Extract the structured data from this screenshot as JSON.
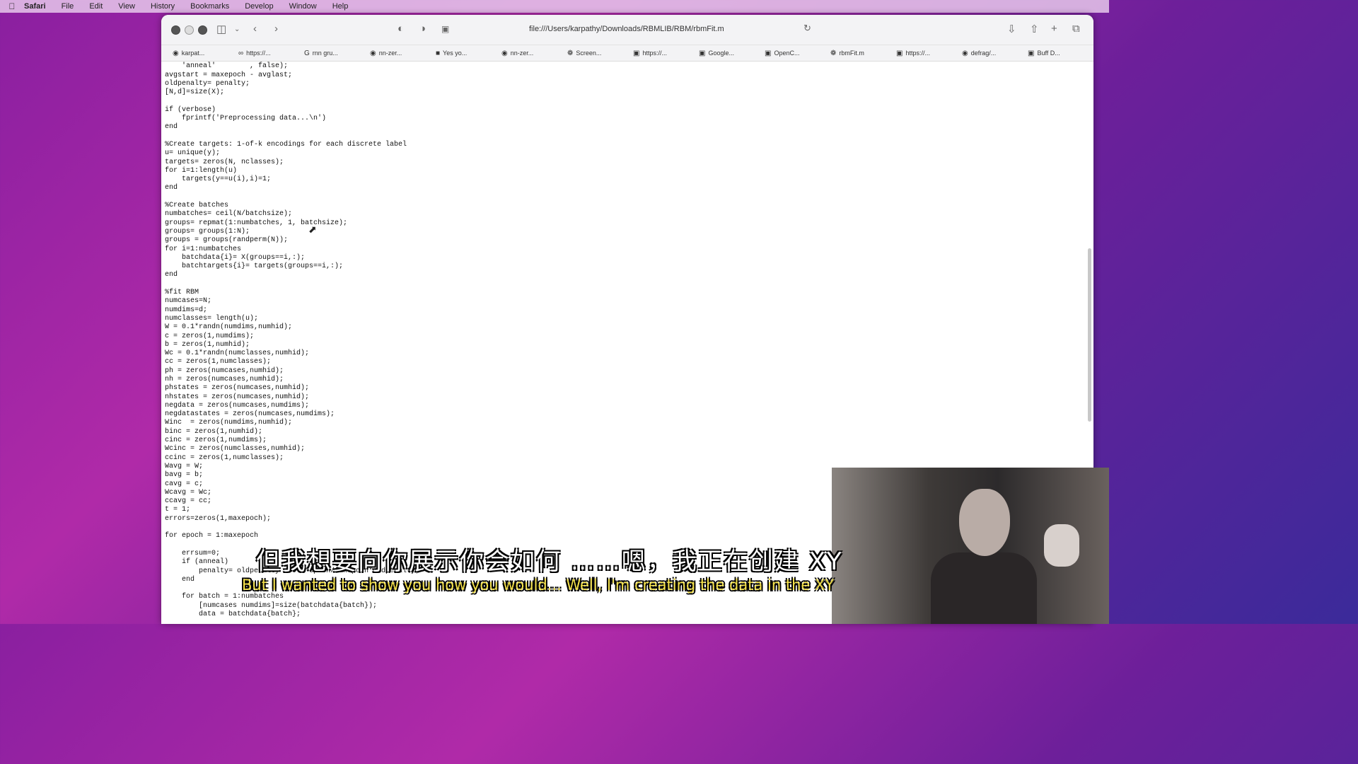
{
  "menubar": {
    "items": [
      "Safari",
      "File",
      "Edit",
      "View",
      "History",
      "Bookmarks",
      "Develop",
      "Window",
      "Help"
    ]
  },
  "browser": {
    "url": "file:///Users/karpathy/Downloads/RBMLIB/RBM/rbmFit.m",
    "bookmarks": [
      {
        "label": "karpat...",
        "icon": "github-icon"
      },
      {
        "label": "https://...",
        "icon": "link-icon"
      },
      {
        "label": "rnn gru...",
        "icon": "google-icon"
      },
      {
        "label": "nn-zer...",
        "icon": "github-icon"
      },
      {
        "label": "Yes yo...",
        "icon": "video-icon"
      },
      {
        "label": "nn-zer...",
        "icon": "github-icon"
      },
      {
        "label": "Screen...",
        "icon": "openai-icon"
      },
      {
        "label": "https://...",
        "icon": "page-icon"
      },
      {
        "label": "Google...",
        "icon": "page-icon"
      },
      {
        "label": "OpenC...",
        "icon": "page-icon"
      },
      {
        "label": "rbmFit.m",
        "icon": "openai-icon"
      },
      {
        "label": "https://...",
        "icon": "page-icon"
      },
      {
        "label": "defrag/...",
        "icon": "github-icon"
      },
      {
        "label": "Buff D...",
        "icon": "page-icon"
      }
    ]
  },
  "code": "    'verbose'       , false     , ...\n    'anneal'        , false);\navgstart = maxepoch - avglast;\noldpenalty= penalty;\n[N,d]=size(X);\n\nif (verbose)\n    fprintf('Preprocessing data...\\n')\nend\n\n%Create targets: 1-of-k encodings for each discrete label\nu= unique(y);\ntargets= zeros(N, nclasses);\nfor i=1:length(u)\n    targets(y==u(i),i)=1;\nend\n\n%Create batches\nnumbatches= ceil(N/batchsize);\ngroups= repmat(1:numbatches, 1, batchsize);\ngroups= groups(1:N);\ngroups = groups(randperm(N));\nfor i=1:numbatches\n    batchdata{i}= X(groups==i,:);\n    batchtargets{i}= targets(groups==i,:);\nend\n\n%fit RBM\nnumcases=N;\nnumdims=d;\nnumclasses= length(u);\nW = 0.1*randn(numdims,numhid);\nc = zeros(1,numdims);\nb = zeros(1,numhid);\nWc = 0.1*randn(numclasses,numhid);\ncc = zeros(1,numclasses);\nph = zeros(numcases,numhid);\nnh = zeros(numcases,numhid);\nphstates = zeros(numcases,numhid);\nnhstates = zeros(numcases,numhid);\nnegdata = zeros(numcases,numdims);\nnegdatastates = zeros(numcases,numdims);\nWinc  = zeros(numdims,numhid);\nbinc = zeros(1,numhid);\ncinc = zeros(1,numdims);\nWcinc = zeros(numclasses,numhid);\nccinc = zeros(1,numclasses);\nWavg = W;\nbavg = b;\ncavg = c;\nWcavg = Wc;\nccavg = cc;\nt = 1;\nerrors=zeros(1,maxepoch);\n\nfor epoch = 1:maxepoch\n\n    errsum=0;\n    if (anneal)\n        penalty= oldpenalty - 0.9*epoch/maxepoch*oldpenalty;\n    end\n\n    for batch = 1:numbatches\n        [numcases numdims]=size(batchdata{batch});\n        data = batchdata{batch};",
  "subtitles": {
    "chinese": "但我想要向你展示你会如何 ……嗯，我正在创建 XY",
    "english": "But I wanted to show you how you would... Well, I'm creating the data in the XY"
  }
}
